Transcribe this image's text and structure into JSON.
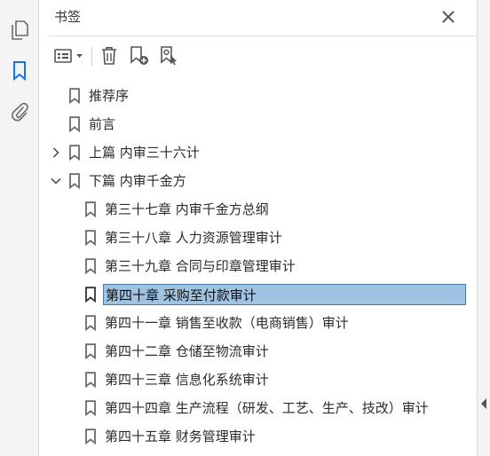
{
  "panel": {
    "title": "书签"
  },
  "rail": {
    "icons": [
      "pages-icon",
      "bookmark-icon",
      "attachment-icon"
    ],
    "accent": "#1473e6"
  },
  "toolbar": {
    "icons": [
      "options-menu-icon",
      "delete-icon",
      "new-bookmark-icon",
      "new-bookmark-from-structure-icon"
    ]
  },
  "tree": {
    "items": [
      {
        "label": "推荐序",
        "level": 0,
        "expandable": false,
        "expanded": false,
        "selected": false
      },
      {
        "label": "前言",
        "level": 0,
        "expandable": false,
        "expanded": false,
        "selected": false
      },
      {
        "label": "上篇 内审三十六计",
        "level": 0,
        "expandable": true,
        "expanded": false,
        "selected": false
      },
      {
        "label": "下篇 内审千金方",
        "level": 0,
        "expandable": true,
        "expanded": true,
        "selected": false
      },
      {
        "label": "第三十七章 内审千金方总纲",
        "level": 1,
        "expandable": false,
        "expanded": false,
        "selected": false
      },
      {
        "label": "第三十八章 人力资源管理审计",
        "level": 1,
        "expandable": false,
        "expanded": false,
        "selected": false
      },
      {
        "label": "第三十九章 合同与印章管理审计",
        "level": 1,
        "expandable": false,
        "expanded": false,
        "selected": false
      },
      {
        "label": "第四十章 采购至付款审计",
        "level": 1,
        "expandable": false,
        "expanded": false,
        "selected": true
      },
      {
        "label": "第四十一章 销售至收款（电商销售）审计",
        "level": 1,
        "expandable": false,
        "expanded": false,
        "selected": false
      },
      {
        "label": "第四十二章 仓储至物流审计",
        "level": 1,
        "expandable": false,
        "expanded": false,
        "selected": false
      },
      {
        "label": "第四十三章 信息化系统审计",
        "level": 1,
        "expandable": false,
        "expanded": false,
        "selected": false
      },
      {
        "label": "第四十四章 生产流程（研发、工艺、生产、技改）审计",
        "level": 1,
        "expandable": false,
        "expanded": false,
        "selected": false
      },
      {
        "label": "第四十五章 财务管理审计",
        "level": 1,
        "expandable": false,
        "expanded": false,
        "selected": false
      }
    ]
  },
  "colors": {
    "selection_fill": "#9fc3e0",
    "selection_border": "#4a78a8",
    "icon_gray": "#6b6b6b"
  }
}
